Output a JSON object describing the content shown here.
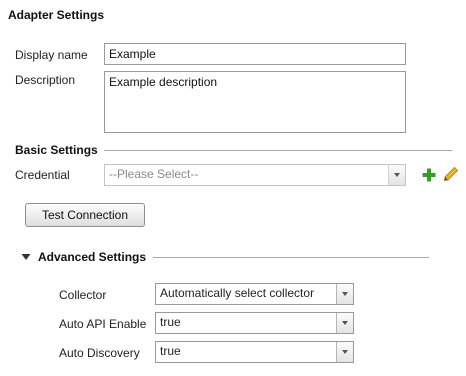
{
  "panel": {
    "title": "Adapter Settings"
  },
  "fields": {
    "display_name": {
      "label": "Display name",
      "value": "Example"
    },
    "description": {
      "label": "Description",
      "value": "Example description"
    }
  },
  "basic": {
    "heading": "Basic Settings",
    "credential": {
      "label": "Credential",
      "placeholder": "--Please Select--"
    },
    "add_icon": "plus-icon",
    "edit_icon": "pencil-icon",
    "test_button": "Test Connection"
  },
  "advanced": {
    "heading": "Advanced Settings",
    "expanded": true,
    "collector": {
      "label": "Collector",
      "value": "Automatically select collector"
    },
    "auto_api_enable": {
      "label": "Auto API Enable",
      "value": "true"
    },
    "auto_discovery": {
      "label": "Auto Discovery",
      "value": "true"
    }
  },
  "colors": {
    "add_green": "#3a9a2a",
    "edit_yellow": "#e6b52a",
    "rule": "#a8a8a8"
  }
}
